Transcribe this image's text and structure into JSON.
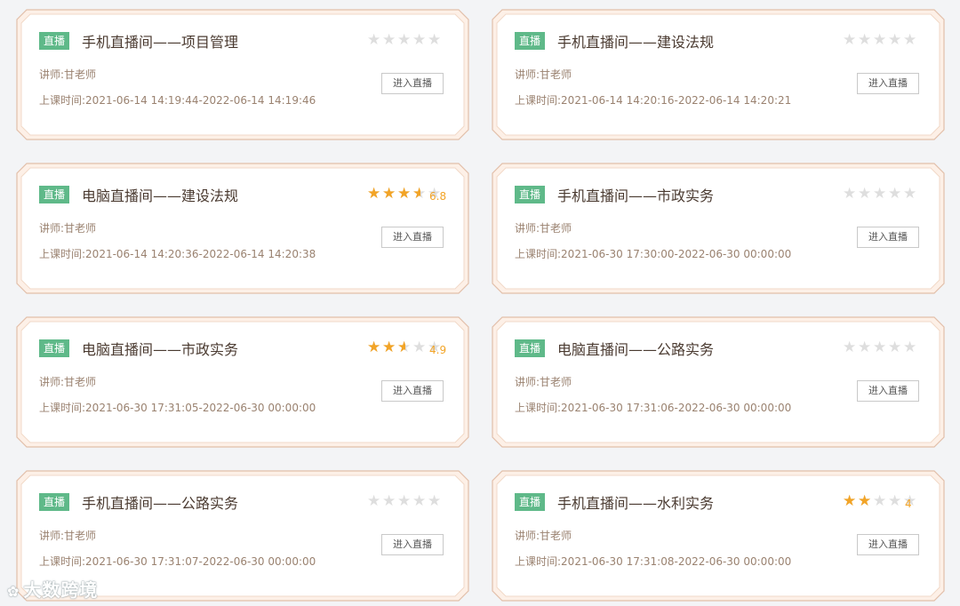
{
  "accent": "#5fb989",
  "star_color": "#f2a427",
  "cards": [
    {
      "tag": "直播",
      "title": "手机直播间——项目管理",
      "lecturer": "讲师:甘老师",
      "time": "上课时间:2021-06-14 14:19:44-2022-06-14 14:19:46",
      "button": "进入直播",
      "rating": 0,
      "score": ""
    },
    {
      "tag": "直播",
      "title": "手机直播间——建设法规",
      "lecturer": "讲师:甘老师",
      "time": "上课时间:2021-06-14 14:20:16-2022-06-14 14:20:21",
      "button": "进入直播",
      "rating": 0,
      "score": ""
    },
    {
      "tag": "直播",
      "title": "电脑直播间——建设法规",
      "lecturer": "讲师:甘老师",
      "time": "上课时间:2021-06-14 14:20:36-2022-06-14 14:20:38",
      "button": "进入直播",
      "rating": 3.5,
      "score": "6.8"
    },
    {
      "tag": "直播",
      "title": "手机直播间——市政实务",
      "lecturer": "讲师:甘老师",
      "time": "上课时间:2021-06-30 17:30:00-2022-06-30 00:00:00",
      "button": "进入直播",
      "rating": 0,
      "score": ""
    },
    {
      "tag": "直播",
      "title": "电脑直播间——市政实务",
      "lecturer": "讲师:甘老师",
      "time": "上课时间:2021-06-30 17:31:05-2022-06-30 00:00:00",
      "button": "进入直播",
      "rating": 2.5,
      "score": "4.9"
    },
    {
      "tag": "直播",
      "title": "电脑直播间——公路实务",
      "lecturer": "讲师:甘老师",
      "time": "上课时间:2021-06-30 17:31:06-2022-06-30 00:00:00",
      "button": "进入直播",
      "rating": 0,
      "score": ""
    },
    {
      "tag": "直播",
      "title": "手机直播间——公路实务",
      "lecturer": "讲师:甘老师",
      "time": "上课时间:2021-06-30 17:31:07-2022-06-30 00:00:00",
      "button": "进入直播",
      "rating": 0,
      "score": ""
    },
    {
      "tag": "直播",
      "title": "手机直播间——水利实务",
      "lecturer": "讲师:甘老师",
      "time": "上课时间:2021-06-30 17:31:08-2022-06-30 00:00:00",
      "button": "进入直播",
      "rating": 2,
      "score": "4"
    }
  ],
  "watermark": "大数跨境",
  "watermark_icon": "sunflower-icon"
}
